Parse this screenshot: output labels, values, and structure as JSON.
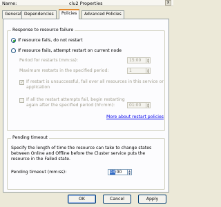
{
  "window": {
    "title_prefix": "Name:",
    "title_suffix": "clu2 Properties",
    "close_glyph": "x"
  },
  "tabs": [
    "General",
    "Dependencies",
    "Policies",
    "Advanced Policies"
  ],
  "response": {
    "group_title": "Response to resource failure",
    "no_restart_label": "If resource fails, do not restart",
    "restart_label": "If resource fails, attempt restart on current node",
    "period_label": "Period for restarts (mm:ss):",
    "period_value": "15:00",
    "max_restarts_label": "Maximum restarts in the specified period:",
    "max_restarts_value": "1",
    "failover_label_1": "If restart is unsuccessful, fail over all resources in this service or",
    "failover_label_2": "application",
    "retry_label_1": "If all the restart attempts fail, begin restarting",
    "retry_label_2": "again after the specified period (hh:mm):",
    "retry_value": "01:00",
    "more_link": "More about restart policies"
  },
  "pending": {
    "group_title": "Pending timeout",
    "description_1": "Specify the length of time the resource can take to change states",
    "description_2": "between Online and Offline before the Cluster service puts the",
    "description_3": "resource in the Failed state.",
    "timeout_label": "Pending timeout (mm:ss):",
    "timeout_selected": "03",
    "timeout_rest": ":00"
  },
  "buttons": {
    "ok": "OK",
    "cancel": "Cancel",
    "apply": "Apply"
  }
}
